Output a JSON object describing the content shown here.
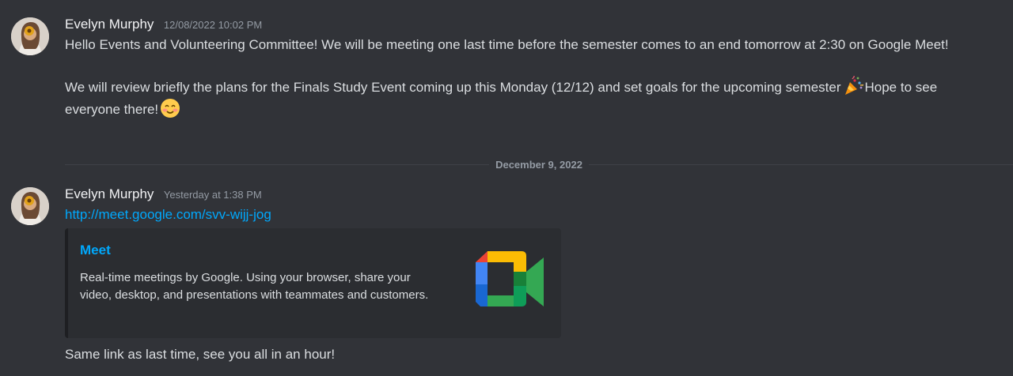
{
  "messages": [
    {
      "username": "Evelyn Murphy",
      "timestamp": "12/08/2022 10:02 PM",
      "para1": "Hello Events and Volunteering Committee! We will be meeting one last time before the semester comes to an end tomorrow at 2:30 on Google Meet!",
      "para2_before_emoji": "We will review briefly the plans for the Finals Study Event coming up this Monday (12/12) and set goals for the upcoming semester",
      "para2_after_emoji": "Hope to see everyone there!",
      "emojis": [
        "party-popper-icon",
        "smiling-face-icon"
      ]
    },
    {
      "username": "Evelyn Murphy",
      "timestamp": "Yesterday at 1:38 PM",
      "link": "http://meet.google.com/svv-wijj-jog",
      "embed": {
        "title": "Meet",
        "description": "Real-time meetings by Google. Using your browser, share your video, desktop, and presentations with teammates and customers.",
        "thumbnail_icon": "google-meet-logo-icon"
      },
      "followup": "Same link as last time, see you all in an hour!"
    }
  ],
  "divider_date": "December 9, 2022",
  "colors": {
    "background": "#313338",
    "link": "#00a8fc",
    "embed_background": "#2b2d31",
    "timestamp": "#949ba4"
  }
}
